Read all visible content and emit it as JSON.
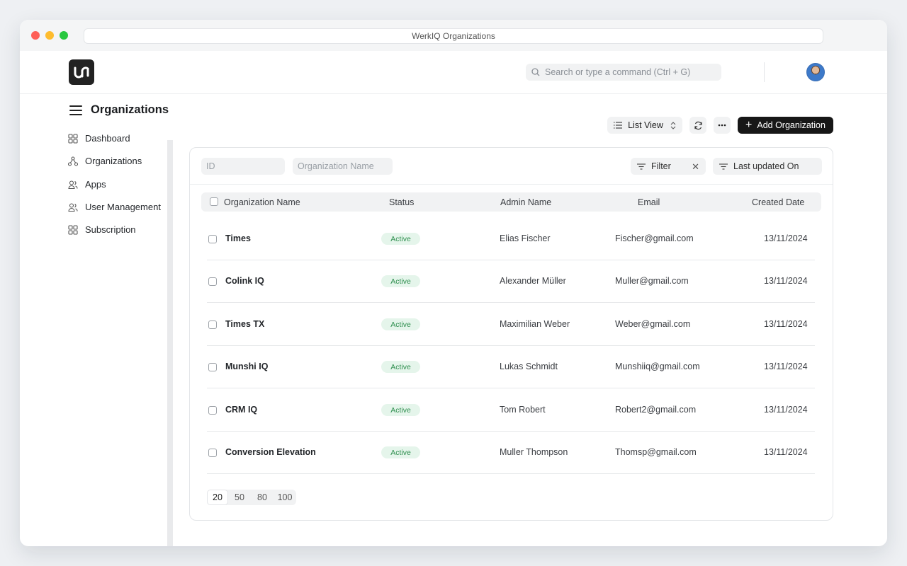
{
  "window": {
    "title": "WerkIQ Organizations"
  },
  "header": {
    "search_placeholder": "Search or type a command (Ctrl + G)"
  },
  "page": {
    "title": "Organizations"
  },
  "sidebar": {
    "items": [
      {
        "label": "Dashboard",
        "icon": "grid-icon"
      },
      {
        "label": "Organizations",
        "icon": "hierarchy-icon"
      },
      {
        "label": "Apps",
        "icon": "users-icon"
      },
      {
        "label": "User Management",
        "icon": "users-icon"
      },
      {
        "label": "Subscription",
        "icon": "grid-icon"
      }
    ]
  },
  "toolbar": {
    "view_label": "List View",
    "add_label": "Add Organization"
  },
  "filters": {
    "id_placeholder": "ID",
    "name_placeholder": "Organization Name",
    "filter_label": "Filter",
    "sort_label": "Last updated On"
  },
  "table": {
    "columns": [
      "Organization Name",
      "Status",
      "Admin Name",
      "Email",
      "Created Date"
    ],
    "rows": [
      {
        "name": "Times",
        "status": "Active",
        "admin": "Elias Fischer",
        "email": "Fischer@gmail.com",
        "date": "13/11/2024"
      },
      {
        "name": "Colink IQ",
        "status": "Active",
        "admin": "Alexander Müller",
        "email": "Muller@gmail.com",
        "date": "13/11/2024"
      },
      {
        "name": "Times TX",
        "status": "Active",
        "admin": "Maximilian Weber",
        "email": "Weber@gmail.com",
        "date": "13/11/2024"
      },
      {
        "name": "Munshi IQ",
        "status": "Active",
        "admin": "Lukas Schmidt",
        "email": "Munshiiq@gmail.com",
        "date": "13/11/2024"
      },
      {
        "name": "CRM IQ",
        "status": "Active",
        "admin": "Tom Robert",
        "email": "Robert2@gmail.com",
        "date": "13/11/2024"
      },
      {
        "name": "Conversion Elevation",
        "status": "Active",
        "admin": "Muller Thompson",
        "email": "Thomsp@gmail.com",
        "date": "13/11/2024"
      }
    ]
  },
  "pagination": {
    "sizes": [
      "20",
      "50",
      "80",
      "100"
    ],
    "selected": "20"
  },
  "colors": {
    "primary_button": "#171717",
    "status_active_bg": "#e5f5eb",
    "status_active_text": "#2f8f4f"
  }
}
